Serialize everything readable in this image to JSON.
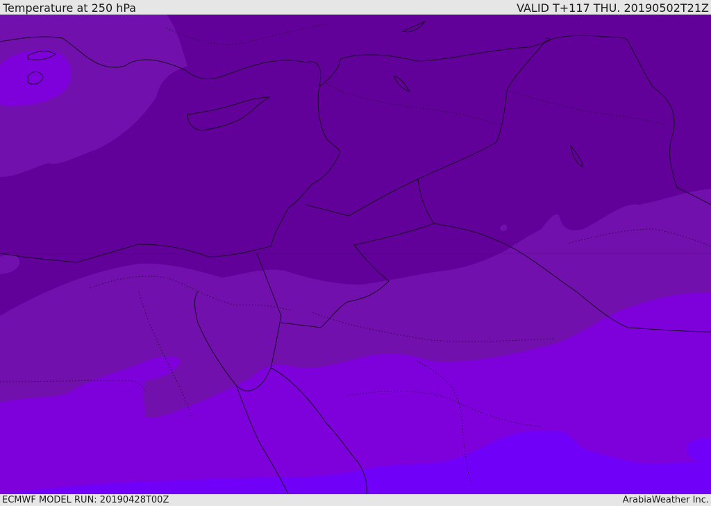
{
  "header": {
    "title": "Temperature at 250 hPa",
    "valid": "VALID T+117 THU. 20190502T21Z"
  },
  "footer": {
    "model_run": "ECMWF MODEL RUN: 20190428T00Z",
    "credit": "ArabiaWeather Inc."
  },
  "map": {
    "field": "temperature-250hpa",
    "region": "eastern-mediterranean-middle-east",
    "bands": [
      {
        "name": "coldest",
        "color": "#62009a"
      },
      {
        "name": "cold",
        "color": "#7210ae"
      },
      {
        "name": "mild",
        "color": "#7e00da"
      },
      {
        "name": "warmest",
        "color": "#7000f8"
      }
    ],
    "border_color": "#1a0626"
  }
}
